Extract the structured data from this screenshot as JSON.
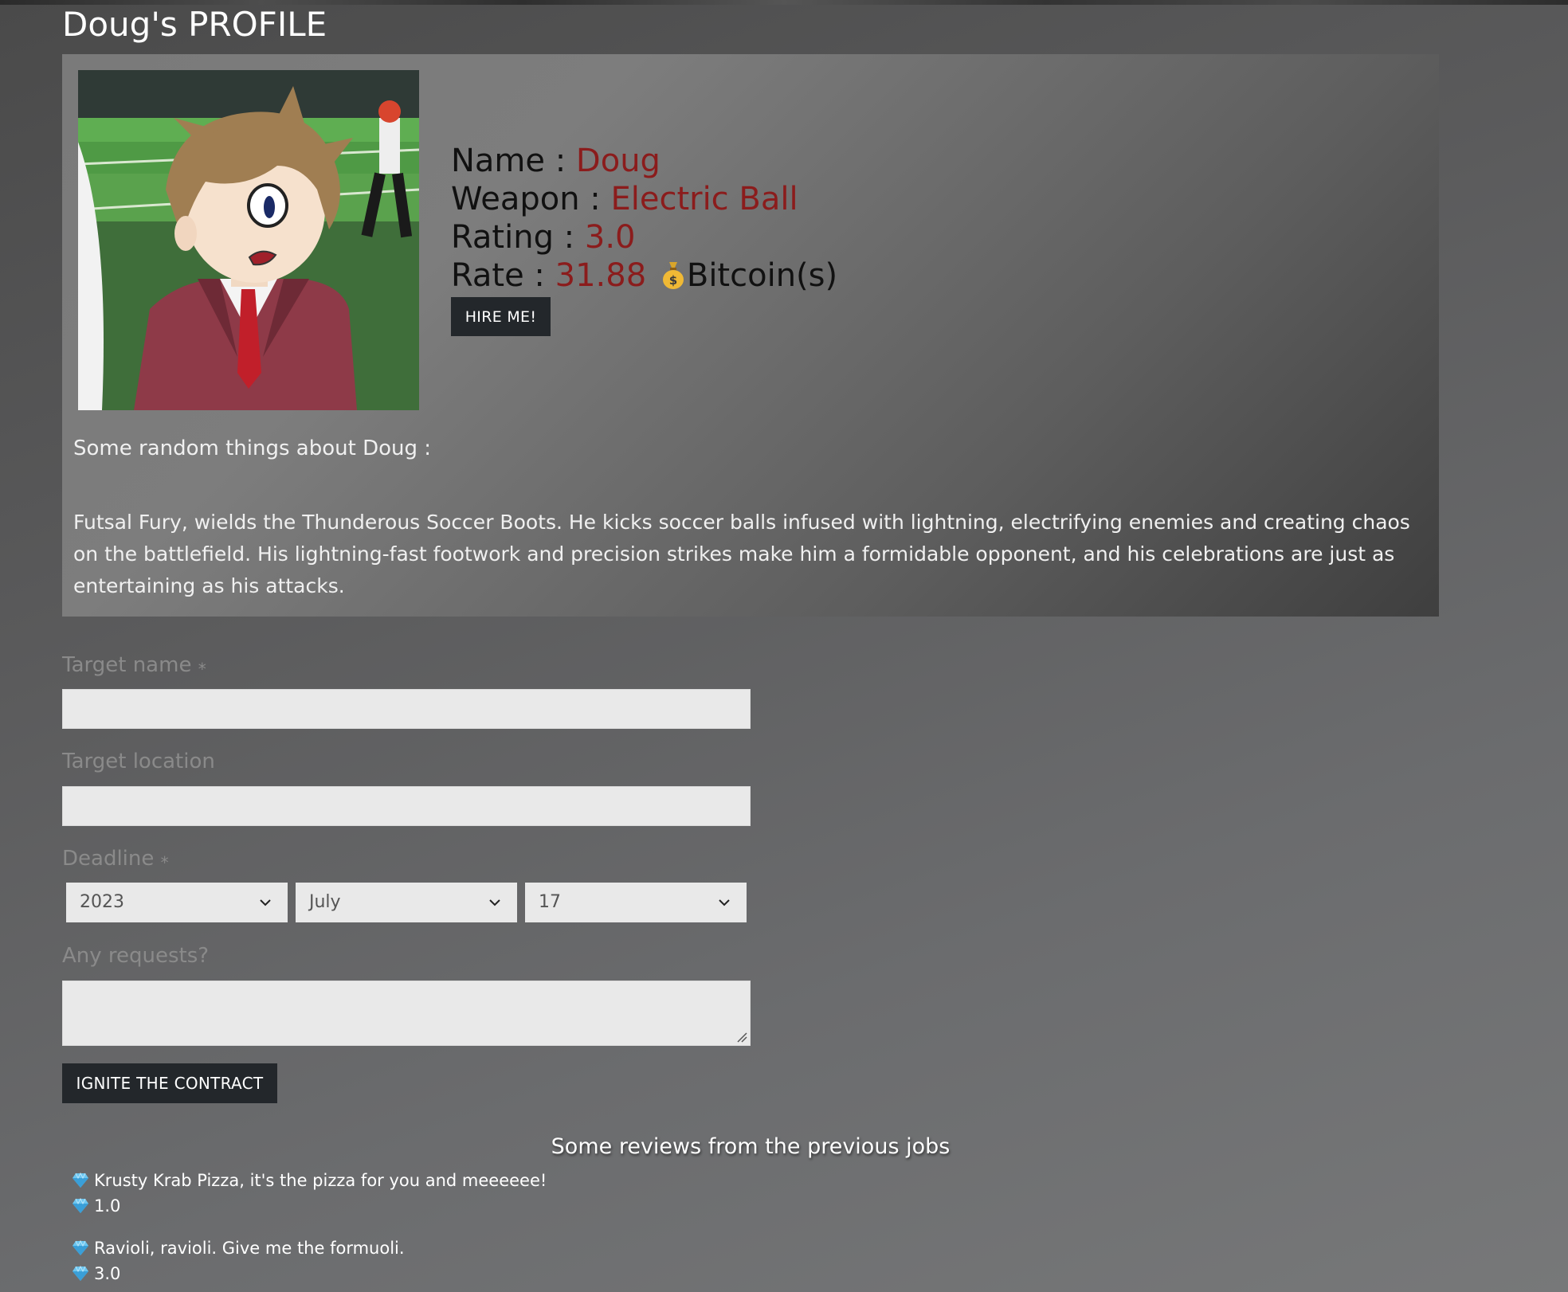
{
  "page": {
    "title": "Doug's PROFILE"
  },
  "profile": {
    "name_label": "Name :",
    "name_value": "Doug",
    "weapon_label": "Weapon :",
    "weapon_value": "Electric Ball",
    "rating_label": "Rating :",
    "rating_value": "3.0",
    "rate_label": "Rate :",
    "rate_value": "31.88",
    "rate_currency": "Bitcoin(s)",
    "hire_button": "HIRE ME!",
    "about_heading": "Some random things about Doug :",
    "about_text": "Futsal Fury, wields the Thunderous Soccer Boots. He kicks soccer balls infused with lightning, electrifying enemies and creating chaos on the battlefield. His lightning-fast footwork and precision strikes make him a formidable opponent, and his celebrations are just as entertaining as his attacks.",
    "value_color": "#8b1c1c"
  },
  "form": {
    "target_name_label": "Target name",
    "target_name_required": "*",
    "target_name_value": "",
    "target_location_label": "Target location",
    "target_location_value": "",
    "deadline_label": "Deadline",
    "deadline_required": "*",
    "deadline_year": "2023",
    "deadline_month": "July",
    "deadline_day": "17",
    "requests_label": "Any requests?",
    "requests_value": "",
    "submit_button": "IGNITE THE CONTRACT"
  },
  "reviews": {
    "heading": "Some reviews from the previous jobs",
    "items": [
      {
        "comment": "Krusty Krab Pizza, it's the pizza for you and meeeeee!",
        "rating": "1.0"
      },
      {
        "comment": "Ravioli, ravioli. Give me the formuoli.",
        "rating": "3.0"
      }
    ]
  },
  "icons": {
    "money": "money-bag-icon",
    "gem": "gem-icon",
    "chevron": "chevron-down-icon"
  }
}
